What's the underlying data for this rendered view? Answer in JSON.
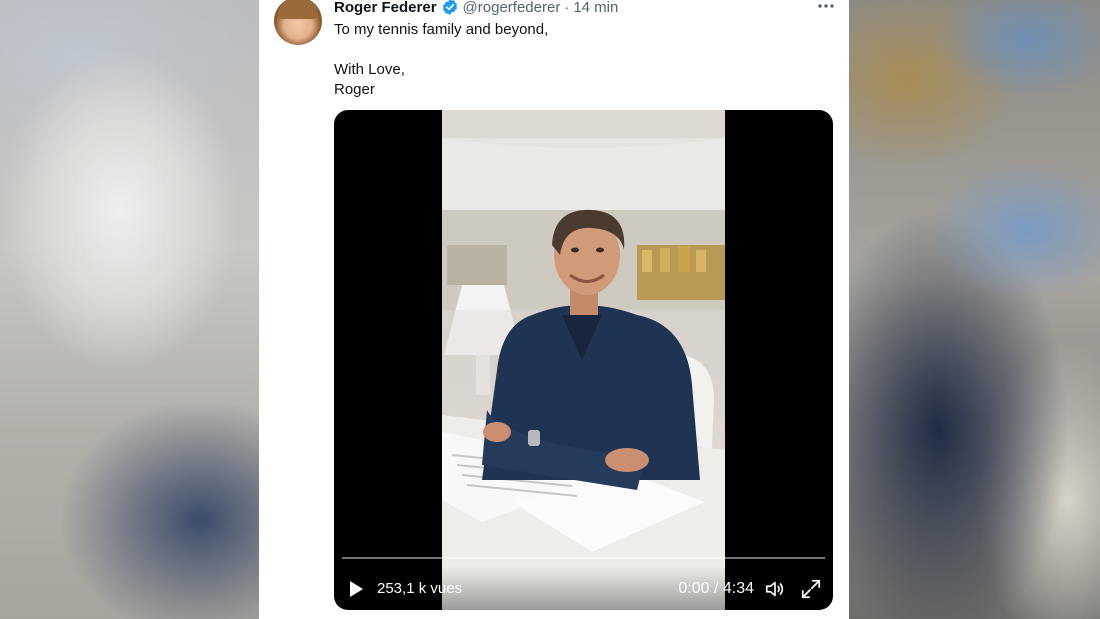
{
  "tweet": {
    "author_name": "Roger Federer",
    "handle": "@rogerfederer",
    "separator": "·",
    "timestamp": "14 min",
    "text_lines": [
      "To my tennis family and beyond,",
      "With Love,",
      "Roger"
    ],
    "more_icon": "more-horizontal-icon",
    "verified_icon": "verified-badge-icon"
  },
  "video": {
    "views": "253,1 k vues",
    "timecode": "0:00 / 4:34",
    "progress": 0.0,
    "play_icon": "play-icon",
    "volume_icon": "volume-icon",
    "fullscreen_icon": "fullscreen-icon"
  },
  "colors": {
    "verified_blue": "#1d9bf0",
    "text_primary": "#0f1419",
    "text_secondary": "#536471",
    "video_bg": "#000000"
  }
}
